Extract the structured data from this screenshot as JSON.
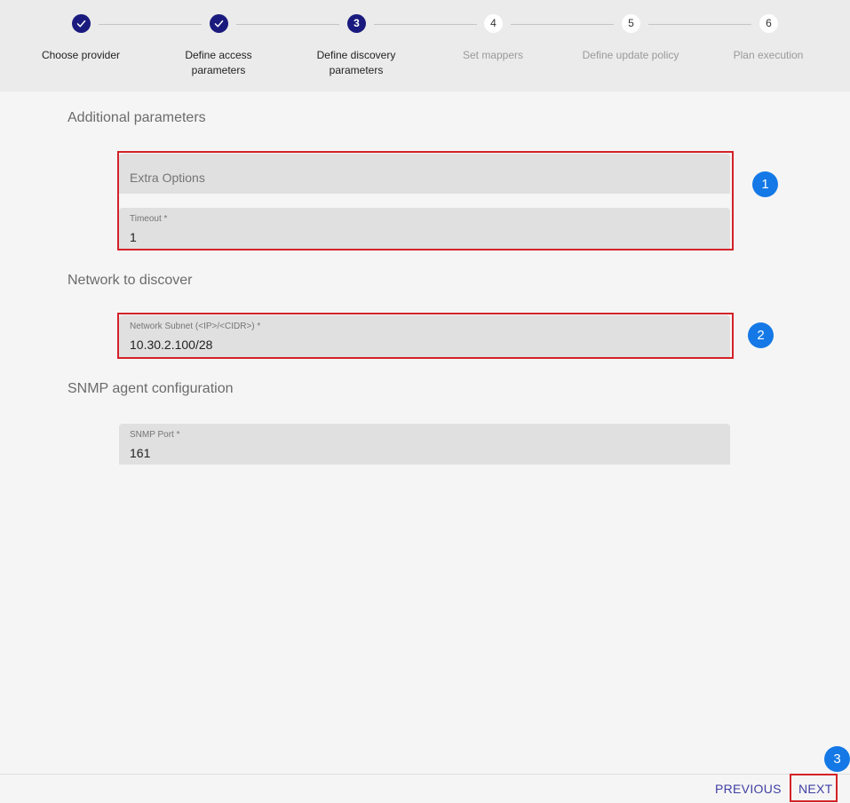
{
  "stepper": {
    "steps": [
      {
        "number": "1",
        "label_line1": "Choose provider",
        "label_line2": "",
        "state": "done"
      },
      {
        "number": "2",
        "label_line1": "Define access",
        "label_line2": "parameters",
        "state": "done"
      },
      {
        "number": "3",
        "label_line1": "Define discovery",
        "label_line2": "parameters",
        "state": "active"
      },
      {
        "number": "4",
        "label_line1": "Set mappers",
        "label_line2": "",
        "state": "pending"
      },
      {
        "number": "5",
        "label_line1": "Define update policy",
        "label_line2": "",
        "state": "pending"
      },
      {
        "number": "6",
        "label_line1": "Plan execution",
        "label_line2": "",
        "state": "pending"
      }
    ]
  },
  "sections": {
    "additional": {
      "title": "Additional parameters",
      "extra_options_placeholder": "Extra Options",
      "timeout_label": "Timeout *",
      "timeout_value": "1"
    },
    "network": {
      "title": "Network to discover",
      "subnet_label": "Network Subnet (<IP>/<CIDR>) *",
      "subnet_value": "10.30.2.100/28"
    },
    "snmp": {
      "title": "SNMP agent configuration",
      "port_label": "SNMP Port *",
      "port_value": "161"
    }
  },
  "callouts": [
    "1",
    "2",
    "3"
  ],
  "footer": {
    "previous_label": "PREVIOUS",
    "next_label": "NEXT"
  },
  "colors": {
    "step_active": "#1a1a7e",
    "highlight": "#d32228",
    "callout": "#1479e6",
    "button_text": "#3f3fa3"
  }
}
